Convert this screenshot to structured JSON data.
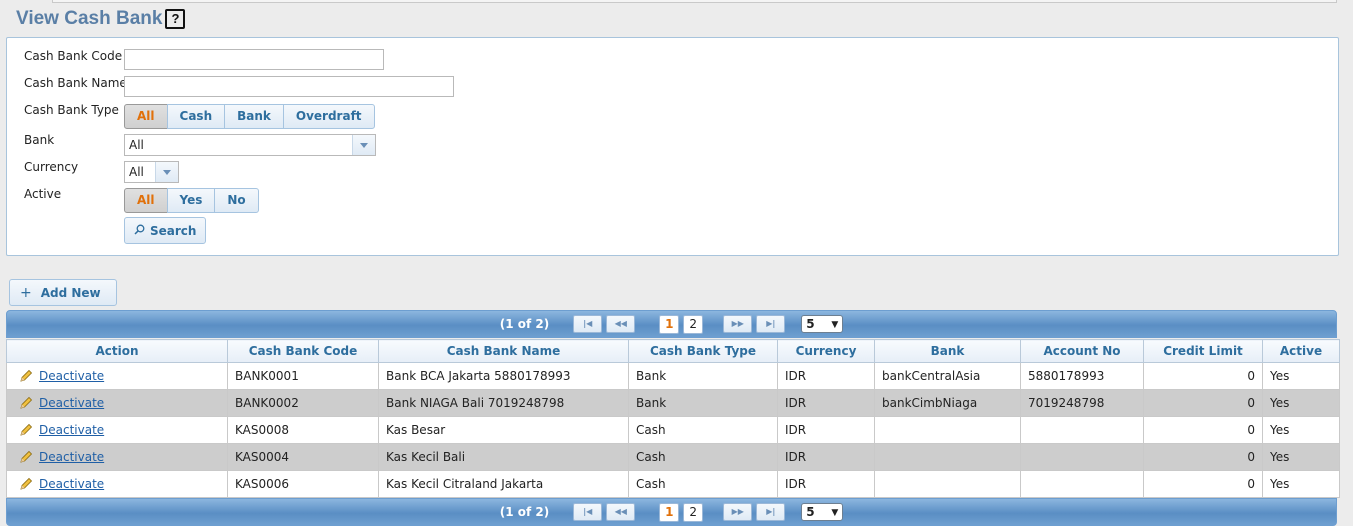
{
  "page": {
    "title": "View Cash Bank",
    "help_label": "?"
  },
  "filters": {
    "cash_bank_code": {
      "label": "Cash Bank Code",
      "value": ""
    },
    "cash_bank_name": {
      "label": "Cash Bank Name",
      "value": ""
    },
    "cash_bank_type": {
      "label": "Cash Bank Type",
      "options": [
        "All",
        "Cash",
        "Bank",
        "Overdraft"
      ],
      "selected": "All"
    },
    "bank": {
      "label": "Bank",
      "value": "All"
    },
    "currency": {
      "label": "Currency",
      "value": "All"
    },
    "active": {
      "label": "Active",
      "options": [
        "All",
        "Yes",
        "No"
      ],
      "selected": "All"
    },
    "search_label": "Search"
  },
  "add_new_label": "Add New",
  "pager": {
    "summary": "(1 of 2)",
    "pages": [
      "1",
      "2"
    ],
    "current": "1",
    "rows_per_page": "5"
  },
  "table": {
    "columns": [
      "Action",
      "Cash Bank Code",
      "Cash Bank Name",
      "Cash Bank Type",
      "Currency",
      "Bank",
      "Account No",
      "Credit Limit",
      "Active"
    ],
    "rows": [
      {
        "action": "Deactivate",
        "code": "BANK0001",
        "name": "Bank BCA Jakarta 5880178993",
        "type": "Bank",
        "currency": "IDR",
        "bank": "bankCentralAsia",
        "account_no": "5880178993",
        "credit_limit": "0",
        "active": "Yes"
      },
      {
        "action": "Deactivate",
        "code": "BANK0002",
        "name": "Bank NIAGA Bali 7019248798",
        "type": "Bank",
        "currency": "IDR",
        "bank": "bankCimbNiaga",
        "account_no": "7019248798",
        "credit_limit": "0",
        "active": "Yes"
      },
      {
        "action": "Deactivate",
        "code": "KAS0008",
        "name": "Kas Besar",
        "type": "Cash",
        "currency": "IDR",
        "bank": "",
        "account_no": "",
        "credit_limit": "0",
        "active": "Yes"
      },
      {
        "action": "Deactivate",
        "code": "KAS0004",
        "name": "Kas Kecil Bali",
        "type": "Cash",
        "currency": "IDR",
        "bank": "",
        "account_no": "",
        "credit_limit": "0",
        "active": "Yes"
      },
      {
        "action": "Deactivate",
        "code": "KAS0006",
        "name": "Kas Kecil Citraland Jakarta",
        "type": "Cash",
        "currency": "IDR",
        "bank": "",
        "account_no": "",
        "credit_limit": "0",
        "active": "Yes"
      }
    ]
  },
  "icons": {
    "edit": "pencil-icon",
    "add": "plus-icon",
    "search": "magnifier-icon",
    "help": "question-icon"
  },
  "colors": {
    "accent": "#e17009",
    "header_blue": "#5a8ec4",
    "title": "#5a7fa6",
    "link": "#1f5fa6"
  }
}
